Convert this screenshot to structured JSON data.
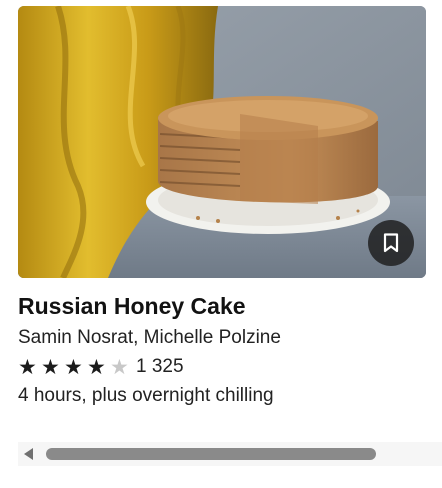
{
  "recipe": {
    "title": "Russian Honey Cake",
    "authors": "Samin Nosrat, Michelle Polzine",
    "rating": 4,
    "rating_max": 5,
    "rating_count": "1 325",
    "time": "4 hours, plus overnight chilling",
    "image_icon": "bookmark-icon"
  },
  "colors": {
    "title": "#121212",
    "star_filled": "#1c1c1c",
    "star_empty": "#c8c8c8",
    "scroll_thumb": "#8a8a8a"
  }
}
